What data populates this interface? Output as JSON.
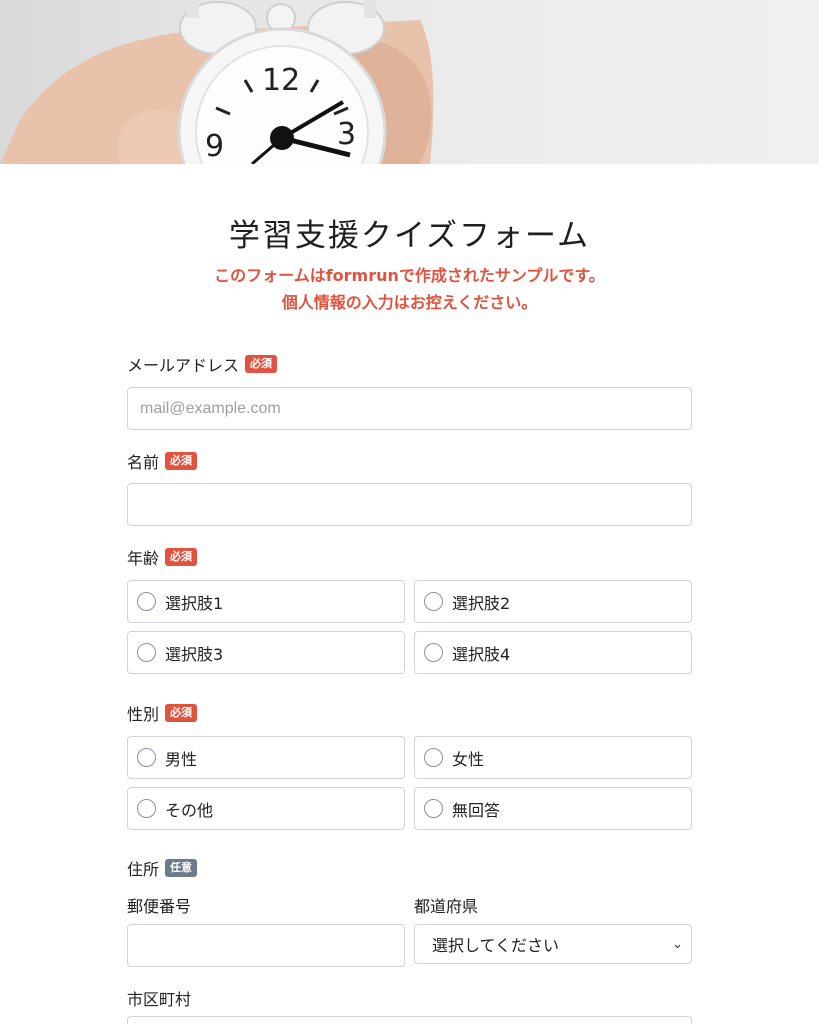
{
  "hero": {
    "image": "alarm-clock-photo",
    "clock_numbers": [
      "12",
      "3",
      "9"
    ]
  },
  "form": {
    "title": "学習支援クイズフォーム",
    "notice_line1_pre": "このフォームは",
    "notice_brand": "formrun",
    "notice_line1_post": "で作成されたサンプルです。",
    "notice_line2": "個人情報の入力はお控えください。"
  },
  "badges": {
    "required": "必須",
    "optional": "任意"
  },
  "fields": {
    "email": {
      "label": "メールアドレス",
      "placeholder": "mail@example.com",
      "value": ""
    },
    "name": {
      "label": "名前",
      "value": ""
    },
    "age": {
      "label": "年齢",
      "options": [
        "選択肢1",
        "選択肢2",
        "選択肢3",
        "選択肢4"
      ]
    },
    "gender": {
      "label": "性別",
      "options": [
        "男性",
        "女性",
        "その他",
        "無回答"
      ]
    },
    "address": {
      "label": "住所",
      "postal_label": "郵便番号",
      "postal_value": "",
      "prefecture_label": "都道府県",
      "prefecture_selected": "選択してください",
      "city_label": "市区町村"
    }
  },
  "colors": {
    "accent": "#e0533f",
    "optional_badge": "#6c7a89",
    "border": "#d0d4d8"
  }
}
